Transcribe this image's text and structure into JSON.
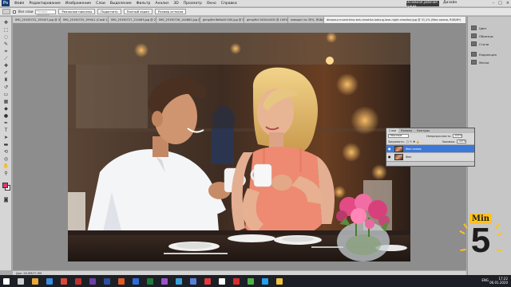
{
  "menubar": {
    "items": [
      "Файл",
      "Редактирование",
      "Изображение",
      "Слои",
      "Выделение",
      "Фильтр",
      "Анализ",
      "3D",
      "Просмотр",
      "Окно",
      "Справка"
    ],
    "workspace_button": "Основная рабочая среда",
    "workspace_label": "Дизайн"
  },
  "options": {
    "checkbox_label": "Все слои",
    "placeholder": "Размер образца",
    "btn_scrubby": "Реальные пикселы",
    "btn_fit": "Подогнать",
    "btn_fill": "Полный экран",
    "btn_print": "Размер оттиска"
  },
  "tabs": [
    {
      "label": "IMG_20190722_195457.jpg @ 46,7% (C, RGB/8)"
    },
    {
      "label": "IMG_20190725_1994/1 (Слой 1, RGB/8)"
    },
    {
      "label": "IMG_20190727_114063.jpg @ 25% (Слой..."
    },
    {
      "label": "IMG_20190728_144662.jpg @ 25% (C..."
    },
    {
      "label": "gimp/ftd 6bfbe2f-500.jpg @ 50%"
    },
    {
      "label": "gimp/ftd 1000x1000 @ 100%"
    },
    {
      "label": "поворот по 30%, RGB/8"
    },
    {
      "label": "dinosaur-mushchina-koh-chashka-lodung-lase-night-chovitaz.jpg @ 31,2% (Мои копии, RGB/8*)"
    }
  ],
  "active_tab_index": 7,
  "status": {
    "text": "Док: 28,9M/37,9M"
  },
  "dock": [
    {
      "label": "Цвет"
    },
    {
      "label": "Образцы"
    },
    {
      "label": "Стили"
    },
    {
      "label": "Коррекция"
    },
    {
      "label": "Маски"
    }
  ],
  "layers_panel": {
    "tabs": [
      "Слои",
      "Каналы",
      "Контуры"
    ],
    "blend_mode": "Обычные",
    "opacity_label": "Непрозрачность:",
    "opacity_value": "100%",
    "lock_label": "Закрепить:",
    "fill_label": "Заливка:",
    "fill_value": "100%",
    "layers": [
      {
        "name": "Фон копия",
        "selected": true
      },
      {
        "name": "Фон",
        "selected": false
      }
    ]
  },
  "badge": {
    "top_text": "Min",
    "number": "5"
  },
  "taskbar": {
    "lang": "ENG",
    "time": "17:22",
    "date": "06.01.2020"
  },
  "colors": {
    "foreground": "#e8336e",
    "background": "#ffffff",
    "accent": "#ffc21c"
  }
}
